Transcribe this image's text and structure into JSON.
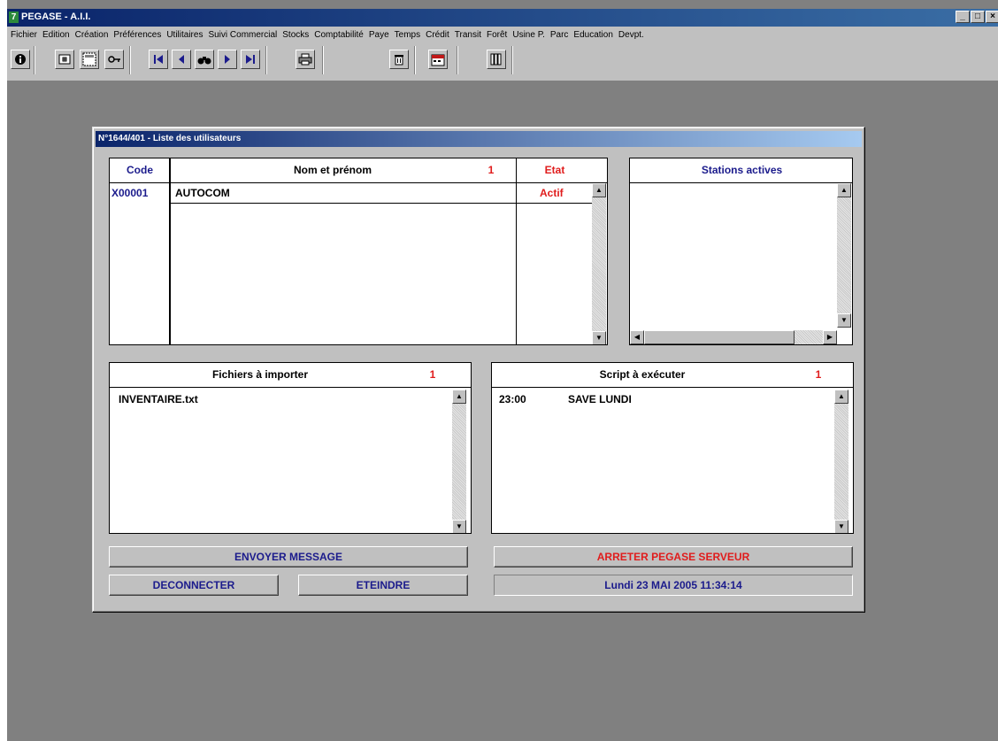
{
  "app": {
    "title": "PEGASE - A.I.I.",
    "icon_glyph": "7",
    "window_controls": {
      "minimize": "_",
      "maximize": "□",
      "close": "×"
    }
  },
  "menu": [
    "Fichier",
    "Edition",
    "Création",
    "Préférences",
    "Utilitaires",
    "Suivi Commercial",
    "Stocks",
    "Comptabilité",
    "Paye",
    "Temps",
    "Crédit",
    "Transit",
    "Forêt",
    "Usine P.",
    "Parc",
    "Education",
    "Devpt."
  ],
  "toolbar": {
    "icons": [
      "info-icon",
      "form-icon",
      "window-icon",
      "key-icon",
      "first-record-icon",
      "previous-record-icon",
      "search-binoculars-icon",
      "next-record-icon",
      "last-record-icon",
      "print-icon",
      "trash-icon",
      "calendar-icon",
      "books-icon"
    ]
  },
  "dialog": {
    "title": "N°1644/401 - Liste des utilisateurs",
    "users": {
      "headers": {
        "code": "Code",
        "name": "Nom et prénom",
        "count": "1",
        "state": "Etat"
      },
      "rows": [
        {
          "code": "X00001",
          "name": "AUTOCOM",
          "state": "Actif"
        }
      ]
    },
    "stations": {
      "header": "Stations actives"
    },
    "files": {
      "header": "Fichiers à importer",
      "count": "1",
      "rows": [
        "INVENTAIRE.txt"
      ]
    },
    "scripts": {
      "header": "Script à exécuter",
      "count": "1",
      "rows": [
        {
          "time": "23:00",
          "name": "SAVE LUNDI"
        }
      ]
    },
    "buttons": {
      "send_message": "ENVOYER MESSAGE",
      "disconnect": "DECONNECTER",
      "shutdown": "ETEINDRE",
      "stop_server": "ARRETER PEGASE SERVEUR"
    },
    "datetime": "Lundi 23 MAI 2005  11:34:14"
  },
  "colors": {
    "accent_blue": "#1b1b8c",
    "accent_red": "#e01c1c",
    "window_bg": "#c0c0c0",
    "desktop_bg": "#808080"
  }
}
